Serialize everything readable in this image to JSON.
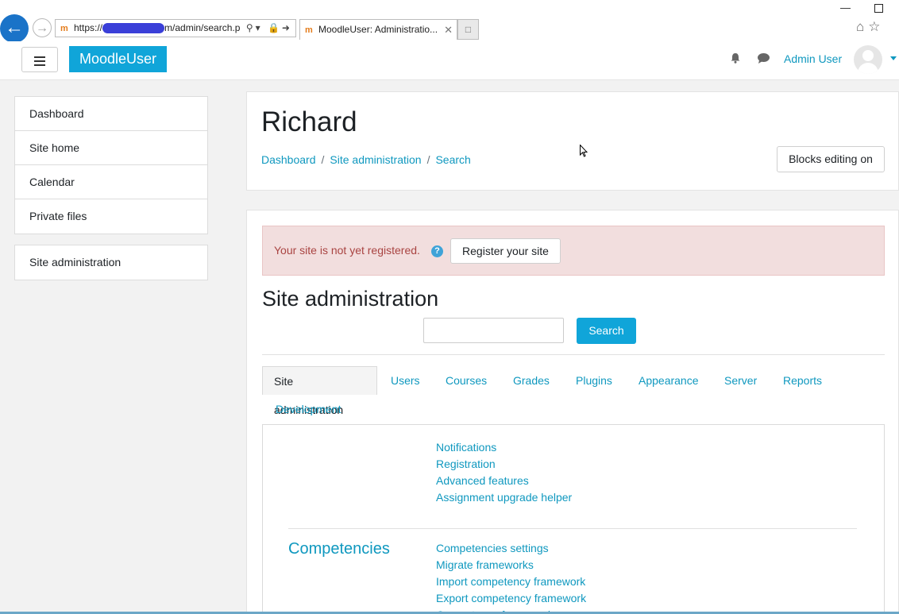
{
  "browser": {
    "url_prefix": "https://",
    "url_suffix": "m/admin/search.p",
    "tab_title": "MoodleUser: Administratio...",
    "tab_close": "✕"
  },
  "navbar": {
    "brand": "MoodleUser",
    "user_name": "Admin User"
  },
  "drawer": {
    "items": [
      "Dashboard",
      "Site home",
      "Calendar",
      "Private files"
    ],
    "admin_item": "Site administration"
  },
  "header": {
    "title": "Richard",
    "breadcrumb": [
      "Dashboard",
      "Site administration",
      "Search"
    ],
    "breadcrumb_sep": "/",
    "blocks_button": "Blocks editing on"
  },
  "alert": {
    "text": "Your site is not yet registered.",
    "help": "?",
    "register_button": "Register your site"
  },
  "admin": {
    "title": "Site administration",
    "search_value": "",
    "search_button": "Search",
    "tabs": [
      "Site administration",
      "Users",
      "Courses",
      "Grades",
      "Plugins",
      "Appearance",
      "Server",
      "Reports",
      "Development"
    ],
    "general_links": [
      "Notifications",
      "Registration",
      "Advanced features",
      "Assignment upgrade helper"
    ],
    "competencies_title": "Competencies",
    "competencies_links": [
      "Competencies settings",
      "Migrate frameworks",
      "Import competency framework",
      "Export competency framework",
      "Competency frameworks"
    ]
  },
  "colors": {
    "brand": "#10a5d9",
    "link": "#0f98bf",
    "alert_bg": "#f2dede",
    "alert_text": "#a94442"
  }
}
